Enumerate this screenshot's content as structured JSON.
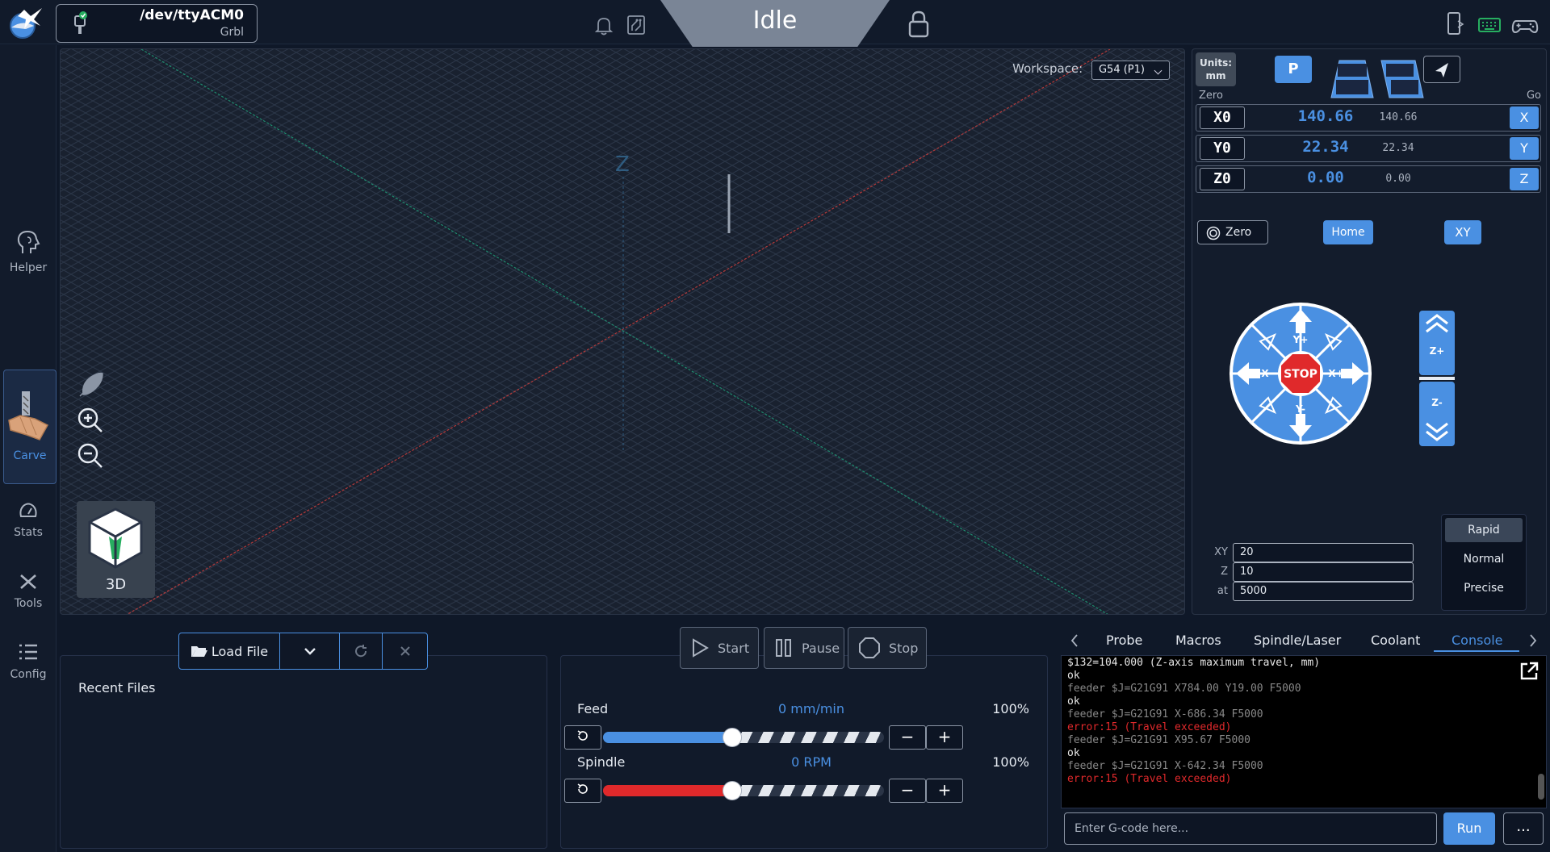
{
  "connection": {
    "port": "/dev/ttyACM0",
    "firmware": "Grbl"
  },
  "status": {
    "state": "Idle"
  },
  "sidebar": {
    "items": [
      {
        "label": "Helper"
      },
      {
        "label": "Carve"
      },
      {
        "label": "Stats"
      },
      {
        "label": "Tools"
      },
      {
        "label": "Config"
      }
    ]
  },
  "visualizer": {
    "workspace_label": "Workspace:",
    "workspace_value": "G54 (P1)",
    "axis_label": "Z",
    "view_label": "3D"
  },
  "dro": {
    "units_label": "Units:",
    "units_value": "mm",
    "p_label": "P",
    "zero_header": "Zero",
    "go_header": "Go",
    "axes": [
      {
        "zero": "X0",
        "work": "140.66",
        "machine": "140.66",
        "go": "X"
      },
      {
        "zero": "Y0",
        "work": "22.34",
        "machine": "22.34",
        "go": "Y"
      },
      {
        "zero": "Z0",
        "work": "0.00",
        "machine": "0.00",
        "go": "Z"
      }
    ],
    "zero_all_label": "Zero",
    "home_label": "Home",
    "xy_label": "XY"
  },
  "jog": {
    "stop_label": "STOP",
    "xp": "X+",
    "xm": "X-",
    "yp": "Y+",
    "ym": "Y-",
    "zp": "Z+",
    "zm": "Z-",
    "xy_label": "XY",
    "xy_value": "20",
    "z_label": "Z",
    "z_value": "10",
    "at_label": "at",
    "at_value": "5000",
    "speeds": [
      "Rapid",
      "Normal",
      "Precise"
    ],
    "selected_speed": "Rapid"
  },
  "files": {
    "load_label": "Load File",
    "recent_label": "Recent Files"
  },
  "job": {
    "start_label": "Start",
    "pause_label": "Pause",
    "stop_label": "Stop",
    "feed_label": "Feed",
    "feed_value": "0 mm/min",
    "feed_pct": "100%",
    "feed_level": 0.46,
    "spindle_label": "Spindle",
    "spindle_value": "0 RPM",
    "spindle_pct": "100%",
    "spindle_level": 0.46
  },
  "tabs": {
    "items": [
      "Probe",
      "Macros",
      "Spindle/Laser",
      "Coolant",
      "Console"
    ],
    "active": "Console"
  },
  "console": {
    "lines": [
      {
        "type": "normal",
        "text": "$132=104.000 (Z-axis maximum travel, mm)"
      },
      {
        "type": "normal",
        "text": "ok"
      },
      {
        "type": "feeder",
        "text": "feeder $J=G21G91 X784.00 Y19.00 F5000"
      },
      {
        "type": "normal",
        "text": "ok"
      },
      {
        "type": "feeder",
        "text": "feeder $J=G21G91 X-686.34 F5000"
      },
      {
        "type": "err",
        "text": "error:15 (Travel exceeded)"
      },
      {
        "type": "feeder",
        "text": "feeder $J=G21G91 X95.67 F5000"
      },
      {
        "type": "normal",
        "text": "ok"
      },
      {
        "type": "feeder",
        "text": "feeder $J=G21G91 X-642.34 F5000"
      },
      {
        "type": "err",
        "text": "error:15 (Travel exceeded)"
      }
    ],
    "placeholder": "Enter G-code here...",
    "run_label": "Run",
    "more_label": "..."
  },
  "colors": {
    "accent": "#4a90e2",
    "stop": "#e0292b",
    "feed": "#4a90e2",
    "spindle": "#e0292b"
  }
}
